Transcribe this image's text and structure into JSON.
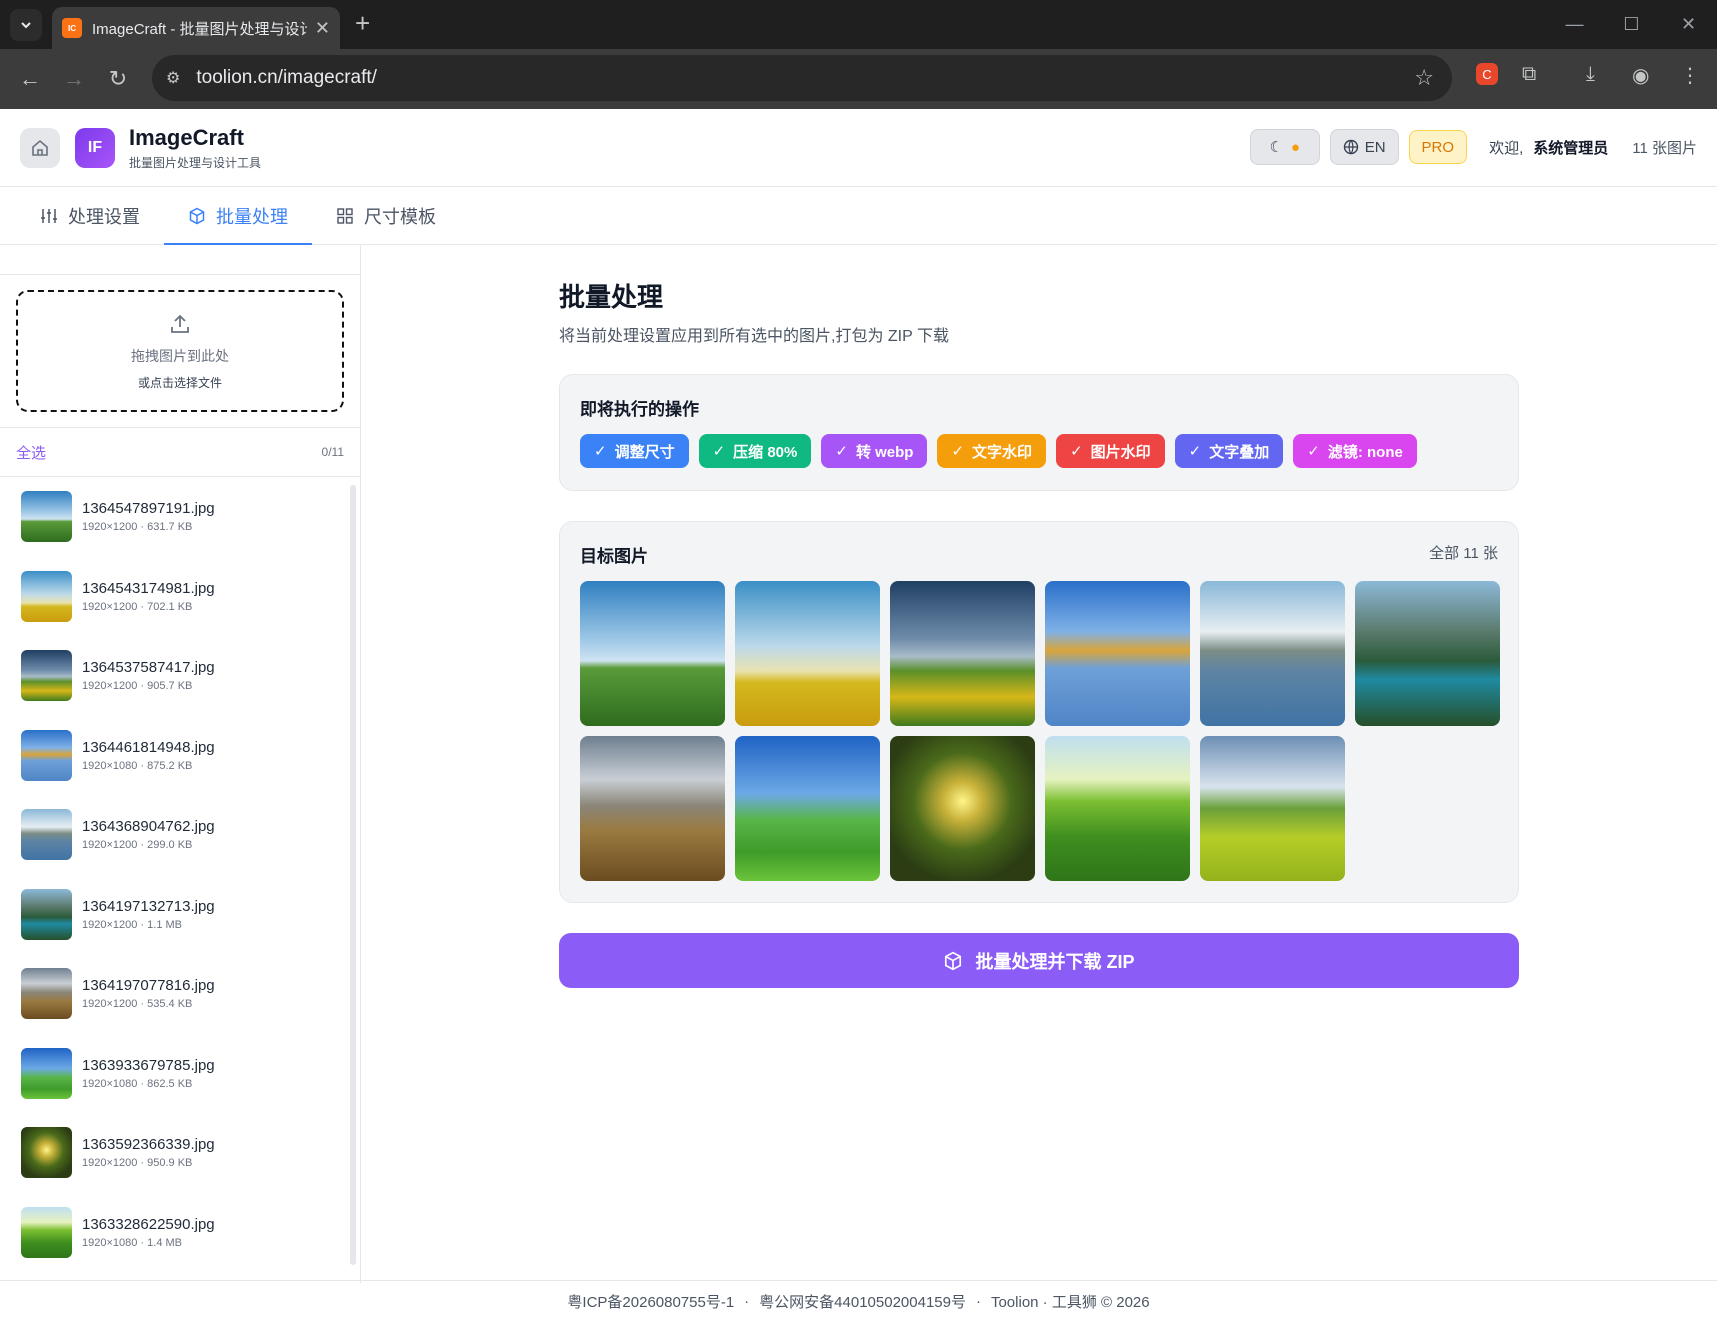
{
  "browser": {
    "tab_title": "ImageCraft - 批量图片处理与设计工具",
    "favicon_text": "IC",
    "url": "toolion.cn/imagecraft/"
  },
  "app": {
    "brand_initials": "IF",
    "name": "ImageCraft",
    "subtitle": "批量图片处理与设计工具",
    "lang_label": "EN",
    "pro_label": "PRO",
    "welcome_label": "欢迎,",
    "user_name": "系统管理员",
    "image_count_label": "11 张图片"
  },
  "tabs": [
    {
      "label": "处理设置",
      "icon": "sliders-icon",
      "active": false
    },
    {
      "label": "批量处理",
      "icon": "package-icon",
      "active": true
    },
    {
      "label": "尺寸模板",
      "icon": "grid-icon",
      "active": false
    }
  ],
  "sidebar": {
    "dropzone_main": "拖拽图片到此处",
    "dropzone_sub": "或点击选择文件",
    "select_all": "全选",
    "selected_count": "0/11",
    "files": [
      {
        "name": "1364547897191.jpg",
        "meta": "1920×1200 · 631.7 KB"
      },
      {
        "name": "1364543174981.jpg",
        "meta": "1920×1200 · 702.1 KB"
      },
      {
        "name": "1364537587417.jpg",
        "meta": "1920×1200 · 905.7 KB"
      },
      {
        "name": "1364461814948.jpg",
        "meta": "1920×1080 · 875.2 KB"
      },
      {
        "name": "1364368904762.jpg",
        "meta": "1920×1200 · 299.0 KB"
      },
      {
        "name": "1364197132713.jpg",
        "meta": "1920×1200 · 1.1 MB"
      },
      {
        "name": "1364197077816.jpg",
        "meta": "1920×1200 · 535.4 KB"
      },
      {
        "name": "1363933679785.jpg",
        "meta": "1920×1080 · 862.5 KB"
      },
      {
        "name": "1363592366339.jpg",
        "meta": "1920×1200 · 950.9 KB"
      },
      {
        "name": "1363328622590.jpg",
        "meta": "1920×1080 · 1.4 MB"
      }
    ]
  },
  "main": {
    "title": "批量处理",
    "subtitle": "将当前处理设置应用到所有选中的图片,打包为 ZIP 下载",
    "ops_title": "即将执行的操作",
    "ops": [
      {
        "label": "调整尺寸",
        "color": "#3b82f6"
      },
      {
        "label": "压缩 80%",
        "color": "#10b981"
      },
      {
        "label": "转 webp",
        "color": "#a855f7"
      },
      {
        "label": "文字水印",
        "color": "#f59e0b"
      },
      {
        "label": "图片水印",
        "color": "#ef4444"
      },
      {
        "label": "文字叠加",
        "color": "#6366f1"
      },
      {
        "label": "滤镜: none",
        "color": "#d946ef"
      }
    ],
    "targets_title": "目标图片",
    "targets_count": "全部 11 张",
    "button_label": "批量处理并下载 ZIP"
  },
  "footer": {
    "icp": "粤ICP备2026080755号-1",
    "sep": "·",
    "police": "粤公网安备44010502004159号",
    "copyright": "Toolion · 工具狮 © 2026"
  }
}
